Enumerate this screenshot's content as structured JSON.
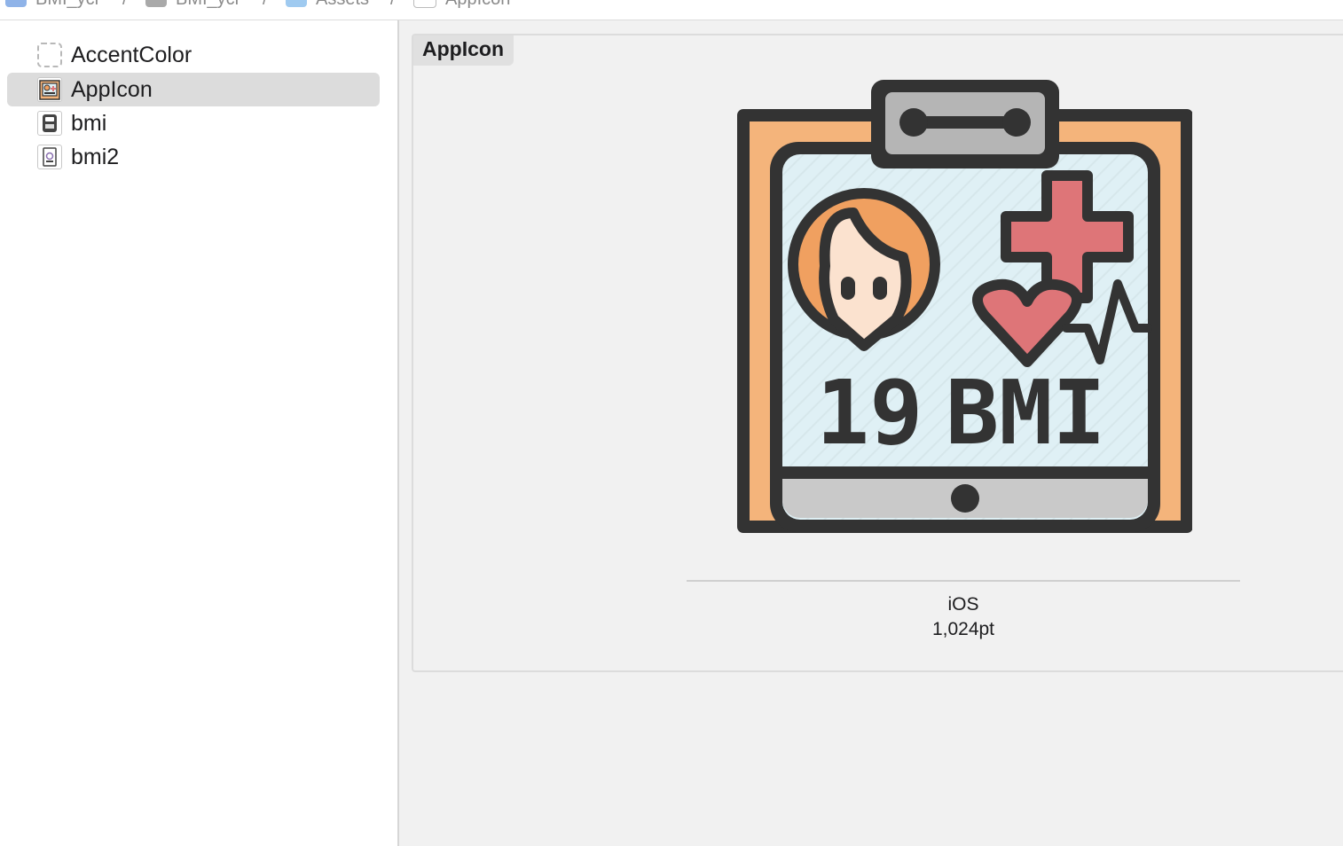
{
  "breadcrumb": {
    "items": [
      {
        "label": "BMI_ycr",
        "icon": "project-icon"
      },
      {
        "label": "BMI_ycr",
        "icon": "folder-icon"
      },
      {
        "label": "Assets",
        "icon": "asset-catalog-icon"
      },
      {
        "label": "AppIcon",
        "icon": "appicon-icon"
      }
    ],
    "separator": "/"
  },
  "sidebar": {
    "items": [
      {
        "label": "AccentColor",
        "icon": "color-set-icon",
        "selected": false
      },
      {
        "label": "AppIcon",
        "icon": "appicon-thumbnail-icon",
        "selected": true
      },
      {
        "label": "bmi",
        "icon": "bmi-image-icon",
        "selected": false
      },
      {
        "label": "bmi2",
        "icon": "bmi2-image-icon",
        "selected": false
      }
    ]
  },
  "editor": {
    "set_title": "AppIcon",
    "slot": {
      "platform": "iOS",
      "size": "1,024pt",
      "image_text": {
        "number": "19",
        "acronym": "BMI"
      }
    }
  },
  "colors": {
    "selection": "#dcdcdc",
    "icon_outline": "#333333",
    "icon_orange": "#f4b47b",
    "icon_screen": "#dff0f5",
    "icon_red": "#de7578",
    "icon_gray": "#c9c9c9"
  }
}
